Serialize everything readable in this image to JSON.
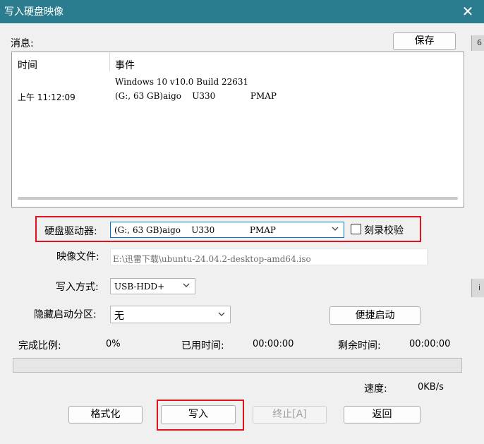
{
  "window": {
    "title": "写入硬盘映像",
    "close_glyph": "✕"
  },
  "edge": {
    "top_label": "6",
    "bottom_label": "i"
  },
  "messages": {
    "label": "消息:",
    "save_button": "保存",
    "columns": [
      "时间",
      "事件"
    ],
    "rows": [
      {
        "time": "",
        "event": "Windows 10 v10.0 Build 22631"
      },
      {
        "time": "上午 11:12:09",
        "event": "(G:, 63 GB)aigo    U330             PMAP"
      }
    ]
  },
  "drive": {
    "label": "硬盘驱动器:",
    "selected": "(G:, 63 GB)aigo    U330             PMAP",
    "verify_label": "刻录校验",
    "verify_checked": false
  },
  "image_file": {
    "label": "映像文件:",
    "value": "E:\\迅雷下载\\ubuntu-24.04.2-desktop-amd64.iso"
  },
  "write_mode": {
    "label": "写入方式:",
    "selected": "USB-HDD+"
  },
  "hidden_partition": {
    "label": "隐藏启动分区:",
    "selected": "无"
  },
  "quick_boot_button": "便捷启动",
  "stats": {
    "completion_label": "完成比例:",
    "completion_value": "0%",
    "elapsed_label": "已用时间:",
    "elapsed_value": "00:00:00",
    "remaining_label": "剩余时间:",
    "remaining_value": "00:00:00",
    "speed_label": "速度:",
    "speed_value": "0KB/s"
  },
  "progress_fraction": 0,
  "buttons": {
    "format": "格式化",
    "write": "写入",
    "stop": "终止[A]",
    "back": "返回"
  },
  "colors": {
    "titlebar": "#2c7c8f",
    "highlight_box": "#e0141e",
    "selection": "#0078d7"
  }
}
